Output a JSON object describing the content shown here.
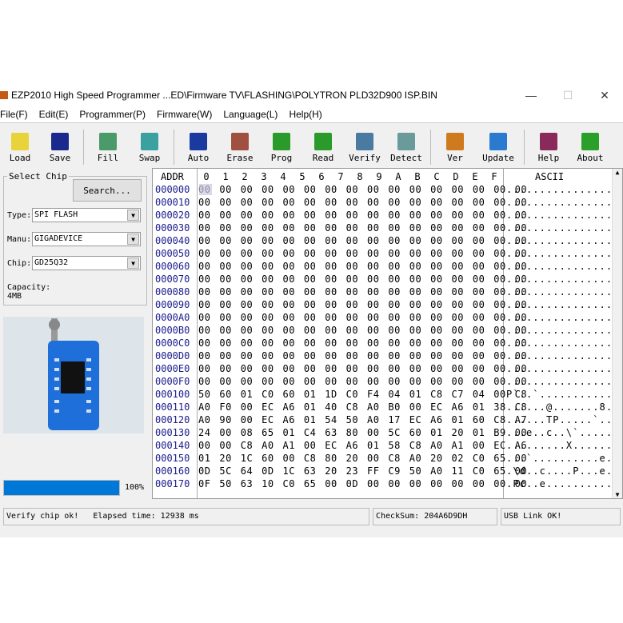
{
  "window": {
    "title": "EZP2010 High Speed Programmer   ...ED\\Firmware TV\\FLASHING\\POLYTRON PLD32D900 ISP.BIN",
    "minimize": "—",
    "maximize": "☐",
    "close": "✕"
  },
  "menu": [
    "File(F)",
    "Edit(E)",
    "Programmer(P)",
    "Firmware(W)",
    "Language(L)",
    "Help(H)"
  ],
  "toolbar": [
    {
      "label": "Load",
      "icon": "folder-open-icon",
      "color": "#e8d33a"
    },
    {
      "label": "Save",
      "icon": "floppy-disk-icon",
      "color": "#1a2a8c"
    },
    {
      "label": "Fill",
      "icon": "fill-icon",
      "color": "#4a9a6a"
    },
    {
      "label": "Swap",
      "icon": "swap-icon",
      "color": "#3aa0a0"
    },
    {
      "label": "Auto",
      "icon": "auto-arrow-icon",
      "color": "#1a3aa0"
    },
    {
      "label": "Erase",
      "icon": "erase-chip-icon",
      "color": "#a05040"
    },
    {
      "label": "Prog",
      "icon": "program-chip-icon",
      "color": "#2a9a2a"
    },
    {
      "label": "Read",
      "icon": "read-chip-icon",
      "color": "#2a9a2a"
    },
    {
      "label": "Verify",
      "icon": "verify-chip-icon",
      "color": "#4a7aa0"
    },
    {
      "label": "Detect",
      "icon": "magnifier-icon",
      "color": "#6a9a9a"
    },
    {
      "label": "Ver",
      "icon": "version-icon",
      "color": "#d07a20"
    },
    {
      "label": "Update",
      "icon": "globe-update-icon",
      "color": "#2a7ad0"
    },
    {
      "label": "Help",
      "icon": "help-book-icon",
      "color": "#8a2a5a"
    },
    {
      "label": "About",
      "icon": "info-icon",
      "color": "#2aa02a"
    }
  ],
  "select_chip": {
    "legend": "Select Chip",
    "search": "Search...",
    "type_label": "Type:",
    "type": "SPI FLASH",
    "manu_label": "Manu:",
    "manu": "GIGADEVICE",
    "chip_label": "Chip:",
    "chip": "GD25Q32",
    "capacity": "Capacity: 4MB"
  },
  "progress": {
    "value": 100,
    "label": "100%"
  },
  "hex": {
    "addr_header": "ADDR",
    "ascii_header": "ASCII",
    "columns": [
      "0",
      "1",
      "2",
      "3",
      "4",
      "5",
      "6",
      "7",
      "8",
      "9",
      "A",
      "B",
      "C",
      "D",
      "E",
      "F"
    ],
    "rows": [
      {
        "addr": "000000",
        "bytes": "00 00 00 00 00 00 00 00 00 00 00 00 00 00 00 00",
        "ascii": "................"
      },
      {
        "addr": "000010",
        "bytes": "00 00 00 00 00 00 00 00 00 00 00 00 00 00 00 00",
        "ascii": "................"
      },
      {
        "addr": "000020",
        "bytes": "00 00 00 00 00 00 00 00 00 00 00 00 00 00 00 00",
        "ascii": "................"
      },
      {
        "addr": "000030",
        "bytes": "00 00 00 00 00 00 00 00 00 00 00 00 00 00 00 00",
        "ascii": "................"
      },
      {
        "addr": "000040",
        "bytes": "00 00 00 00 00 00 00 00 00 00 00 00 00 00 00 00",
        "ascii": "................"
      },
      {
        "addr": "000050",
        "bytes": "00 00 00 00 00 00 00 00 00 00 00 00 00 00 00 00",
        "ascii": "................"
      },
      {
        "addr": "000060",
        "bytes": "00 00 00 00 00 00 00 00 00 00 00 00 00 00 00 00",
        "ascii": "................"
      },
      {
        "addr": "000070",
        "bytes": "00 00 00 00 00 00 00 00 00 00 00 00 00 00 00 00",
        "ascii": "................"
      },
      {
        "addr": "000080",
        "bytes": "00 00 00 00 00 00 00 00 00 00 00 00 00 00 00 00",
        "ascii": "................"
      },
      {
        "addr": "000090",
        "bytes": "00 00 00 00 00 00 00 00 00 00 00 00 00 00 00 00",
        "ascii": "................"
      },
      {
        "addr": "0000A0",
        "bytes": "00 00 00 00 00 00 00 00 00 00 00 00 00 00 00 00",
        "ascii": "................"
      },
      {
        "addr": "0000B0",
        "bytes": "00 00 00 00 00 00 00 00 00 00 00 00 00 00 00 00",
        "ascii": "................"
      },
      {
        "addr": "0000C0",
        "bytes": "00 00 00 00 00 00 00 00 00 00 00 00 00 00 00 00",
        "ascii": "................"
      },
      {
        "addr": "0000D0",
        "bytes": "00 00 00 00 00 00 00 00 00 00 00 00 00 00 00 00",
        "ascii": "................"
      },
      {
        "addr": "0000E0",
        "bytes": "00 00 00 00 00 00 00 00 00 00 00 00 00 00 00 00",
        "ascii": "................"
      },
      {
        "addr": "0000F0",
        "bytes": "00 00 00 00 00 00 00 00 00 00 00 00 00 00 00 00",
        "ascii": "................"
      },
      {
        "addr": "000100",
        "bytes": "50 60 01 C0 60 01 1D C0 F4 04 01 C8 C7 04 00 C8",
        "ascii": "P`..`..........."
      },
      {
        "addr": "000110",
        "bytes": "A0 F0 00 EC A6 01 40 C8 A0 B0 00 EC A6 01 38 C8",
        "ascii": "......@.......8."
      },
      {
        "addr": "000120",
        "bytes": "A0 90 00 EC A6 01 54 50 A0 17 EC A6 01 60 C8 A7",
        "ascii": "......TP.....`.."
      },
      {
        "addr": "000130",
        "bytes": "24 00 08 65 01 C4 63 80 00 5C 60 01 20 01 B9 00",
        "ascii": "...e..c..\\`....."
      },
      {
        "addr": "000140",
        "bytes": "00 00 C8 A0 A1 00 EC A6 01 58 C8 A0 A1 00 EC A6",
        "ascii": ".........X......"
      },
      {
        "addr": "000150",
        "bytes": "01 20 1C 60 00 C8 80 20 00 C8 A0 20 02 C0 65 00",
        "ascii": "...`..........e."
      },
      {
        "addr": "000160",
        "bytes": "0D 5C 64 0D 1C 63 20 23 FF C9 50 A0 11 C0 65 00",
        "ascii": ".\\d..c....P...e."
      },
      {
        "addr": "000170",
        "bytes": "0F 50 63 10 C0 65 00 0D 00 00 00 00 00 00 00 00",
        "ascii": ".Pc..e.........."
      }
    ]
  },
  "status": {
    "message": "Verify chip ok!   Elapsed time: 12938 ms",
    "checksum": "CheckSum: 204A6D9DH",
    "usb": "USB Link OK!"
  }
}
